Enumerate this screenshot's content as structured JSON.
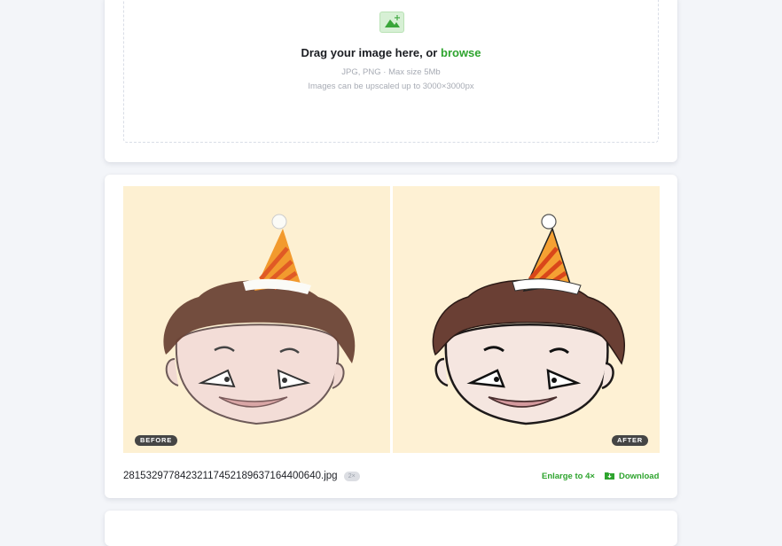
{
  "upload": {
    "icon": "image-upload-icon",
    "title_prefix": "Drag your image here, or",
    "browse_label": "browse",
    "formats_hint": "JPG, PNG · Max size 5Mb",
    "size_hint": "Images can be upscaled up to 3000×3000px"
  },
  "result": {
    "before_badge": "BEFORE",
    "after_badge": "AFTER",
    "filename": "2815329778423211745218963716440064​0.jpg",
    "scale_pill": "2×",
    "enlarge_label": "Enlarge to 4×",
    "download_label": "Download",
    "download_icon": "folder-download-icon"
  },
  "colors": {
    "accent": "#2ea42e",
    "background": "#f3f5f9",
    "image_bg": "#fdf0d2"
  }
}
